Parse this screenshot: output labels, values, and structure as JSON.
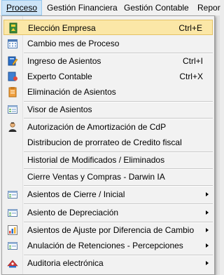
{
  "menubar": {
    "items": [
      {
        "label": "Proceso"
      },
      {
        "label": "Gestión Financiera"
      },
      {
        "label": "Gestión Contable"
      },
      {
        "label": "Repor"
      }
    ]
  },
  "menu": {
    "items": [
      {
        "label": "Elección Empresa",
        "shortcut": "Ctrl+E",
        "icon": "select-company-icon",
        "highlighted": true
      },
      {
        "label": "Cambio mes de Proceso",
        "icon": "calendar-icon"
      },
      {
        "label": "Ingreso de Asientos",
        "shortcut": "Ctrl+I",
        "icon": "entry-book-icon"
      },
      {
        "label": "Experto Contable",
        "shortcut": "Ctrl+X"
      },
      {
        "label": "Eliminación de Asientos",
        "icon": "delete-entries-icon"
      },
      {
        "label": "Visor de Asientos",
        "icon": "entries-viewer-icon"
      },
      {
        "label": "Autorización de Amortización de CdP",
        "icon": "user-authorization-icon"
      },
      {
        "label": "Distribucion de prorrateo de Credito fiscal"
      },
      {
        "label": "Historial de Modificados / Eliminados"
      },
      {
        "label": "Cierre Ventas y Compras - Darwin IA"
      },
      {
        "label": "Asientos de Cierre / Inicial",
        "icon": "closing-entries-icon",
        "submenu": true
      },
      {
        "label": "Asiento de Depreciación",
        "icon": "depreciation-entry-icon",
        "submenu": true
      },
      {
        "label": "Asientos de Ajuste por Diferencia de Cambio",
        "icon": "exchange-adjustment-icon",
        "submenu": true
      },
      {
        "label": "Anulación de Retenciones - Percepciones",
        "icon": "withholding-void-icon",
        "submenu": true
      },
      {
        "label": "Auditoria electrónica",
        "icon": "electronic-audit-icon",
        "submenu": true
      }
    ]
  },
  "colors": {
    "highlight_fill": "#fbe7a7",
    "highlight_border": "#e5c365",
    "menubar_active": "#cce4f7"
  }
}
